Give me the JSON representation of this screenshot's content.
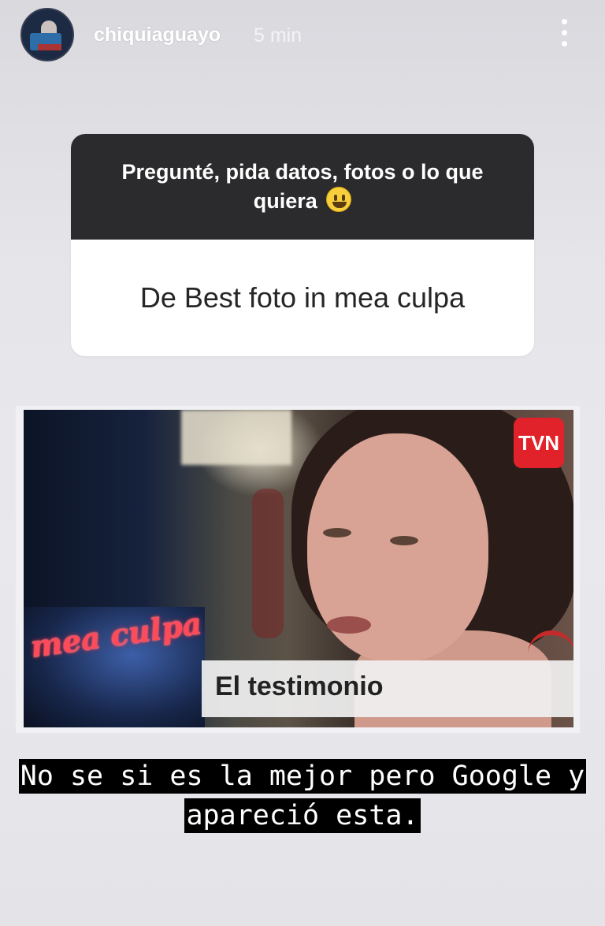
{
  "header": {
    "username": "chiquiaguayo",
    "time_ago": "5 min"
  },
  "question_sticker": {
    "prompt": "Pregunté, pida datos, fotos o lo que quiera",
    "answer": "De Best foto in mea culpa"
  },
  "photo": {
    "channel_logo_text": "TVN",
    "show_logo_text": "mea culpa",
    "segment_title": "El testimonio"
  },
  "caption": {
    "text": "No se si es la mejor pero Google y apareció esta."
  },
  "icons": {
    "more": "more-vertical-icon",
    "emoji": "grinning-face-emoji"
  }
}
